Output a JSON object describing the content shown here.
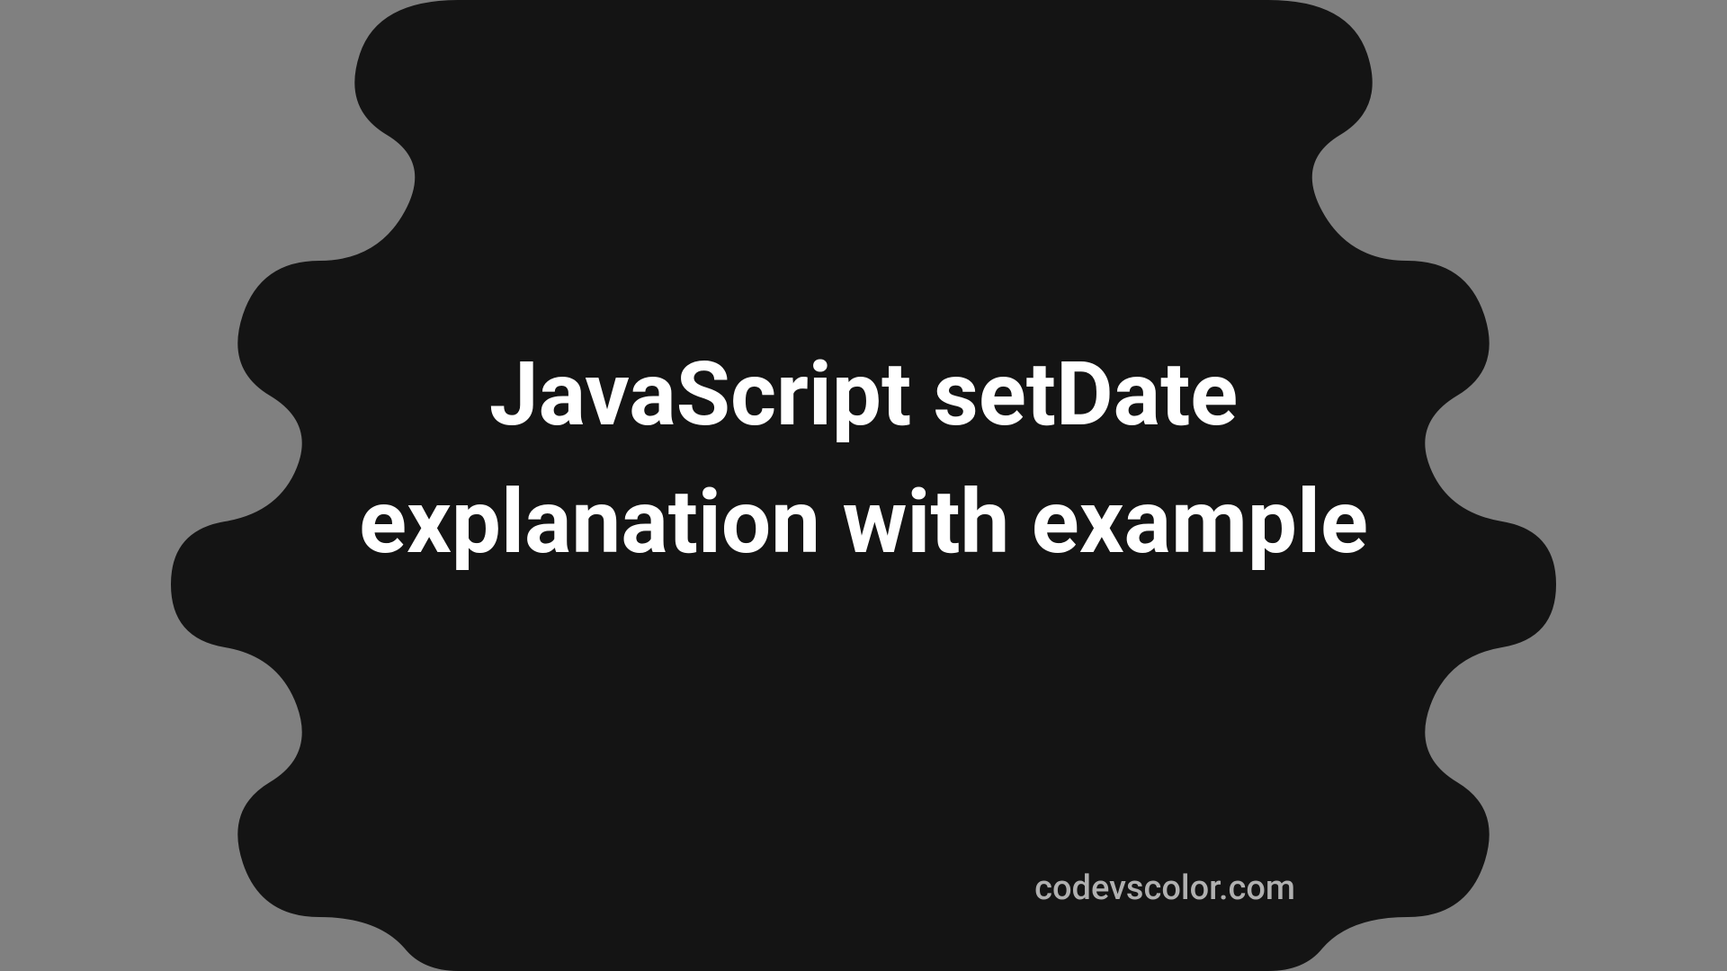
{
  "title": "JavaScript setDate explanation with example",
  "footer": "codevscolor.com",
  "colors": {
    "background": "#808080",
    "blob": "#141414",
    "title_text": "#ffffff",
    "footer_text": "#b0b0b0"
  }
}
